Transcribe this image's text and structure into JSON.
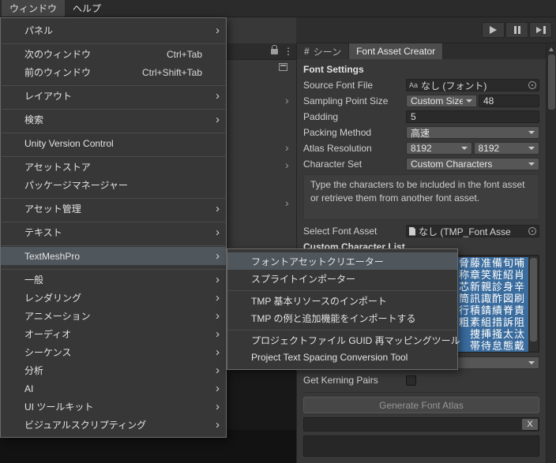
{
  "menubar": {
    "items": [
      {
        "label": "ウィンドウ",
        "open": true
      },
      {
        "label": "ヘルプ"
      }
    ]
  },
  "icons": {
    "chevron_right": "›",
    "kebab": "⋮",
    "hash": "#",
    "font_file": "Aa"
  },
  "window_menu": {
    "items": [
      {
        "label": "パネル",
        "arrow": "›"
      },
      {
        "divider": true
      },
      {
        "label": "次のウィンドウ",
        "shortcut": "Ctrl+Tab"
      },
      {
        "label": "前のウィンドウ",
        "shortcut": "Ctrl+Shift+Tab"
      },
      {
        "divider": true
      },
      {
        "label": "レイアウト",
        "arrow": "›"
      },
      {
        "divider": true
      },
      {
        "label": "検索",
        "arrow": "›"
      },
      {
        "divider": true
      },
      {
        "label": "Unity Version Control"
      },
      {
        "divider": true
      },
      {
        "label": "アセットストア"
      },
      {
        "label": "パッケージマネージャー"
      },
      {
        "divider": true
      },
      {
        "label": "アセット管理",
        "arrow": "›"
      },
      {
        "divider": true
      },
      {
        "label": "テキスト",
        "arrow": "›"
      },
      {
        "divider": true
      },
      {
        "label": "TextMeshPro",
        "arrow": "›",
        "highlighted": true
      },
      {
        "divider": true
      },
      {
        "label": "一般",
        "arrow": "›"
      },
      {
        "label": "レンダリング",
        "arrow": "›"
      },
      {
        "label": "アニメーション",
        "arrow": "›"
      },
      {
        "label": "オーディオ",
        "arrow": "›"
      },
      {
        "label": "シーケンス",
        "arrow": "›"
      },
      {
        "label": "分析",
        "arrow": "›"
      },
      {
        "label": "AI",
        "arrow": "›"
      },
      {
        "label": "UI ツールキット",
        "arrow": "›"
      },
      {
        "label": "ビジュアルスクリプティング",
        "arrow": "›"
      }
    ]
  },
  "textmeshpro_submenu": {
    "items": [
      {
        "label": "フォントアセットクリエーター",
        "highlighted": true
      },
      {
        "label": "スプライトインポーター"
      },
      {
        "divider": true
      },
      {
        "label": "TMP 基本リソースのインポート"
      },
      {
        "label": "TMP の例と追加機能をインポートする"
      },
      {
        "divider": true
      },
      {
        "label": "プロジェクトファイル GUID 再マッピングツール"
      },
      {
        "label": "Project Text Spacing Conversion Tool"
      }
    ]
  },
  "panel": {
    "tabs": {
      "scene": "シーン",
      "font_asset_creator": "Font Asset Creator"
    },
    "section_header": "Font Settings",
    "source_font_file": {
      "label": "Source Font File",
      "value": "なし (フォント)"
    },
    "sampling_point_size": {
      "label": "Sampling Point Size",
      "mode": "Custom Size",
      "value": "48"
    },
    "padding": {
      "label": "Padding",
      "value": "5"
    },
    "packing_method": {
      "label": "Packing Method",
      "value": "高速"
    },
    "atlas_resolution": {
      "label": "Atlas Resolution",
      "width": "8192",
      "height": "8192"
    },
    "character_set": {
      "label": "Character Set",
      "value": "Custom Characters"
    },
    "help_text": "Type the characters to be included in the font asset or retrieve them from another font asset.",
    "select_font_asset": {
      "label": "Select Font Asset",
      "value": "なし (TMP_Font Asse"
    },
    "custom_character_list_label": "Custom Character List",
    "custom_character_list_lines": [
      "段脅藤准備旬哺",
      "称章笑粧紹肖",
      "芯新親診身辛",
      "筒訊諏酢図刷",
      "行積錆績脊責",
      "粗素組措訴阻",
      "捜挿掻太汰",
      "帯待怠態戴"
    ],
    "get_kerning_pairs_label": "Get Kerning Pairs",
    "generate_button_label": "Generate Font Atlas",
    "clear_button_label": "X"
  }
}
